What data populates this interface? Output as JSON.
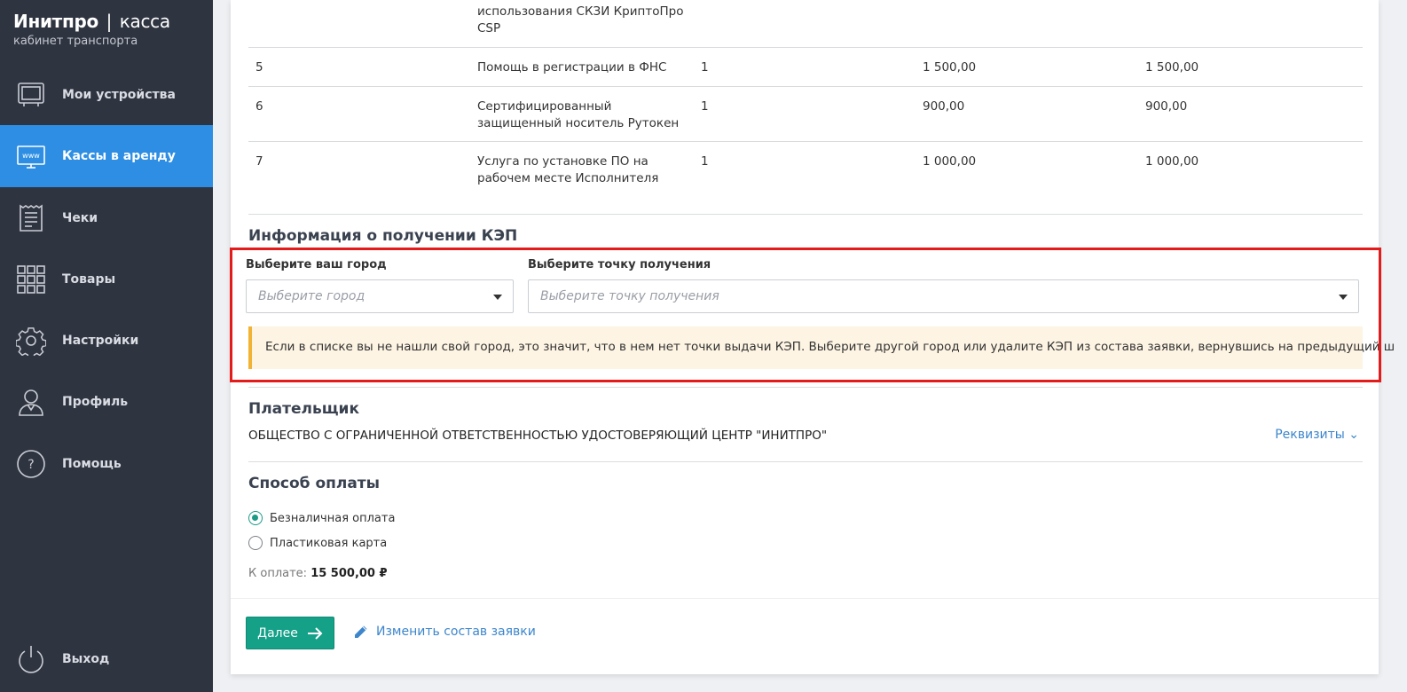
{
  "brand": {
    "name": "Инитпро",
    "separator": "|",
    "product": "касса",
    "subtitle": "кабинет транспорта"
  },
  "sidebar": {
    "items": [
      {
        "label": "Мои устройства",
        "icon": "monitor-icon",
        "active": false
      },
      {
        "label": "Кассы в аренду",
        "icon": "www-icon",
        "active": true
      },
      {
        "label": "Чеки",
        "icon": "receipt-icon",
        "active": false
      },
      {
        "label": "Товары",
        "icon": "grid-icon",
        "active": false
      },
      {
        "label": "Настройки",
        "icon": "gear-icon",
        "active": false
      },
      {
        "label": "Профиль",
        "icon": "user-icon",
        "active": false
      },
      {
        "label": "Помощь",
        "icon": "help-icon",
        "active": false
      }
    ],
    "logout": {
      "label": "Выход",
      "icon": "power-icon"
    }
  },
  "table": {
    "partial_row": {
      "name_line1": "использования СКЗИ КриптоПро",
      "name_line2": "CSP"
    },
    "rows": [
      {
        "num": "5",
        "name_line1": "Помощь в регистрации в ФНС",
        "name_line2": "",
        "qty": "1",
        "price": "1 500,00",
        "sum": "1 500,00"
      },
      {
        "num": "6",
        "name_line1": "Сертифицированный",
        "name_line2": "защищенный носитель Рутокен",
        "qty": "1",
        "price": "900,00",
        "sum": "900,00"
      },
      {
        "num": "7",
        "name_line1": "Услуга по установке ПО на",
        "name_line2": "рабочем месте Исполнителя",
        "qty": "1",
        "price": "1 000,00",
        "sum": "1 000,00"
      }
    ]
  },
  "kep": {
    "title": "Информация о получении КЭП",
    "city_label": "Выберите ваш город",
    "city_placeholder": "Выберите город",
    "point_label": "Выберите точку получения",
    "point_placeholder": "Выберите точку получения",
    "alert": "Если в списке вы не нашли свой город, это значит, что в нем нет точки выдачи КЭП. Выберите другой город или удалите КЭП из состава заявки, вернувшись на предыдущий шаг."
  },
  "payer": {
    "title": "Плательщик",
    "name": "ОБЩЕСТВО С ОГРАНИЧЕННОЙ ОТВЕТСТВЕННОСТЬЮ УДОСТОВЕРЯЮЩИЙ ЦЕНТР \"ИНИТПРО\"",
    "details_link": "Реквизиты ⌄"
  },
  "payment": {
    "title": "Способ оплаты",
    "options": [
      {
        "label": "Безналичная оплата",
        "checked": true
      },
      {
        "label": "Пластиковая карта",
        "checked": false
      }
    ],
    "total_label": "К оплате:",
    "total_value": "15 500,00 ₽"
  },
  "actions": {
    "next_label": "Далее",
    "edit_label": "Изменить состав заявки"
  },
  "colors": {
    "sidebar_bg": "#2f3441",
    "active_nav": "#2d8ee3",
    "primary_button": "#15a088",
    "link": "#3d86cc",
    "alert_bg": "#fdf4e3",
    "alert_border": "#f2b233",
    "highlight": "#e31b1b"
  }
}
